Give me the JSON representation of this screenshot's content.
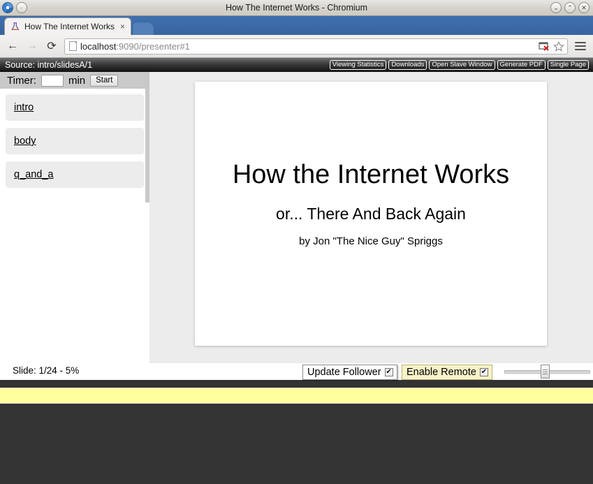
{
  "window": {
    "title": "How The Internet Works - Chromium",
    "logo_icon": "chromium-logo-icon",
    "app_menu_icon": "window-menu-icon",
    "minimize_glyph": "⌄",
    "maximize_glyph": "⌃",
    "close_glyph": "✕"
  },
  "tab": {
    "title": "How The Internet Works",
    "favicon": "flask-icon",
    "close_glyph": "×",
    "new_tab_name": "new-tab-button"
  },
  "toolbar": {
    "back_glyph": "←",
    "forward_glyph": "→",
    "reload_glyph": "⟳",
    "url_host": "localhost",
    "url_rest": ":9090/presenter#1",
    "popup_blocked_icon": "popup-blocked-icon",
    "bookmark_glyph": "☆",
    "menu_icon": "hamburger-menu-icon"
  },
  "sourcebar": {
    "source_label": "Source: intro/slidesA/1",
    "buttons": [
      {
        "label": "Viewing Statistics"
      },
      {
        "label": "Downloads"
      },
      {
        "label": "Open Slave Window"
      },
      {
        "label": "Generate PDF"
      },
      {
        "label": "Single Page"
      }
    ]
  },
  "sidebar": {
    "timer_label": "Timer:",
    "timer_value": "",
    "timer_placeholder": "",
    "timer_unit": "min",
    "timer_start_label": "Start",
    "sections": [
      {
        "label": "intro"
      },
      {
        "label": "body"
      },
      {
        "label": "q_and_a"
      }
    ]
  },
  "slide": {
    "title": "How the Internet Works",
    "subtitle": "or... There And Back Again",
    "author": "by Jon \"The Nice Guy\" Spriggs"
  },
  "statusbar": {
    "slide_counter": "Slide: 1/24 - 5%",
    "update_follower_label": "Update Follower",
    "update_follower_checked": "✔",
    "enable_remote_label": "Enable Remote",
    "enable_remote_checked": "✔",
    "zoom_slider_name": "zoom-slider"
  },
  "colors": {
    "tabstrip": "#3f6fae",
    "sourcebar_dark": "#111111",
    "notes_yellow": "#ffff9e",
    "bottom_dark": "#333333",
    "remote_toggle_yellow": "#f7f2c8"
  }
}
